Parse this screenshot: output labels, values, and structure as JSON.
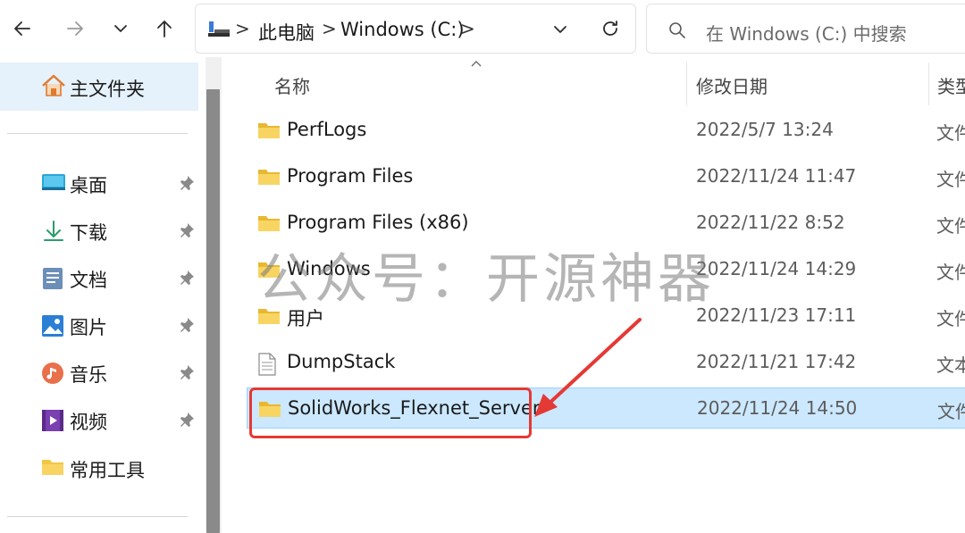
{
  "toolbar": {
    "back": "back",
    "forward": "forward",
    "history": "recent-locations",
    "up": "up"
  },
  "address": {
    "crumbs": [
      "此电脑",
      "Windows (C:)"
    ],
    "separator": ">"
  },
  "search": {
    "placeholder": "在 Windows (C:) 中搜索"
  },
  "sidebar": {
    "home": "主文件夹",
    "items": [
      {
        "label": "桌面",
        "icon": "desktop-icon",
        "pinned": true
      },
      {
        "label": "下载",
        "icon": "download-icon",
        "pinned": true
      },
      {
        "label": "文档",
        "icon": "document-icon",
        "pinned": true
      },
      {
        "label": "图片",
        "icon": "picture-icon",
        "pinned": true
      },
      {
        "label": "音乐",
        "icon": "music-icon",
        "pinned": true
      },
      {
        "label": "视频",
        "icon": "video-icon",
        "pinned": true
      },
      {
        "label": "常用工具",
        "icon": "folder-icon",
        "pinned": false
      }
    ]
  },
  "list": {
    "columns": {
      "name": "名称",
      "modified": "修改日期",
      "type": "类型"
    },
    "rows": [
      {
        "name": "PerfLogs",
        "modified": "2022/5/7 13:24",
        "type": "文件夹",
        "icon": "folder-icon"
      },
      {
        "name": "Program Files",
        "modified": "2022/11/24 11:47",
        "type": "文件夹",
        "icon": "folder-icon"
      },
      {
        "name": "Program Files (x86)",
        "modified": "2022/11/22 8:52",
        "type": "文件夹",
        "icon": "folder-icon"
      },
      {
        "name": "Windows",
        "modified": "2022/11/24 14:29",
        "type": "文件夹",
        "icon": "folder-icon"
      },
      {
        "name": "用户",
        "modified": "2022/11/23 17:11",
        "type": "文件夹",
        "icon": "folder-icon"
      },
      {
        "name": "DumpStack",
        "modified": "2022/11/21 17:42",
        "type": "文本文档",
        "icon": "file-icon"
      },
      {
        "name": "SolidWorks_Flexnet_Server",
        "modified": "2022/11/24 14:50",
        "type": "文件夹",
        "icon": "folder-icon",
        "selected": true
      }
    ]
  },
  "watermark": "公众号：开源神器",
  "colors": {
    "selection": "#cce8ff",
    "annotation": "#e53935",
    "folder": "#f2c744"
  }
}
